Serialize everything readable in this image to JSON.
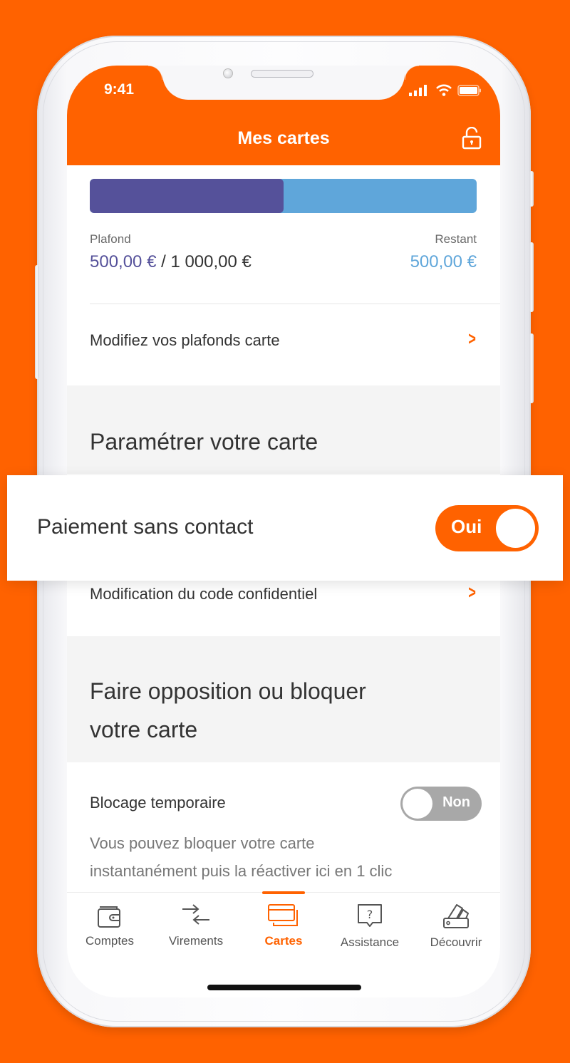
{
  "status_bar": {
    "time": "9:41"
  },
  "header": {
    "title": "Mes cartes",
    "lock_icon": "unlocked-padlock-icon"
  },
  "limit": {
    "used_fraction": 0.5,
    "plafond_label": "Plafond",
    "spent": "500,00 €",
    "separator": " / ",
    "total": "1 000,00 €",
    "restant_label": "Restant",
    "remaining": "500,00 €"
  },
  "rows": {
    "modify_limits": "Modifiez vos plafonds carte",
    "pin_change": "Modification du code confidentiel"
  },
  "sections": {
    "settings_title": "Paramétrer votre carte",
    "block_title_line1": "Faire opposition ou bloquer",
    "block_title_line2": "votre carte"
  },
  "contactless": {
    "label": "Paiement sans contact",
    "toggle_label": "Oui",
    "enabled": true
  },
  "temp_block": {
    "label": "Blocage temporaire",
    "toggle_label": "Non",
    "enabled": false,
    "desc_line1": "Vous pouvez bloquer votre carte",
    "desc_line2": "instantanément puis la réactiver ici en 1 clic"
  },
  "tabs": [
    {
      "label": "Comptes",
      "icon": "wallet-icon",
      "active": false
    },
    {
      "label": "Virements",
      "icon": "transfer-arrows-icon",
      "active": false
    },
    {
      "label": "Cartes",
      "icon": "cards-icon",
      "active": true
    },
    {
      "label": "Assistance",
      "icon": "help-bubble-icon",
      "active": false
    },
    {
      "label": "Découvrir",
      "icon": "swatches-icon",
      "active": false
    }
  ],
  "colors": {
    "brand": "#FF6200",
    "spent": "#55519a",
    "remaining": "#5fa6da",
    "toggle_off": "#a8a8a8"
  }
}
